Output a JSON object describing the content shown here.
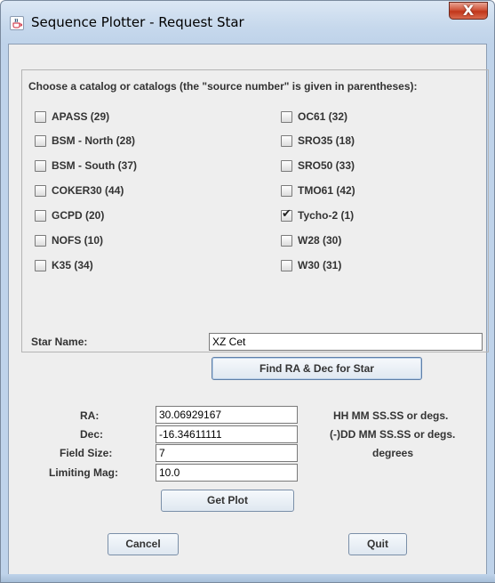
{
  "window": {
    "title": "Sequence Plotter - Request Star",
    "close_glyph": "X",
    "app_icon": "java-cup-icon"
  },
  "catalogs": {
    "heading": "Choose a catalog or catalogs (the \"source number\" is given in parentheses):",
    "left": [
      {
        "label": "APASS (29)",
        "checked": false
      },
      {
        "label": "BSM - North (28)",
        "checked": false
      },
      {
        "label": "BSM - South (37)",
        "checked": false
      },
      {
        "label": "COKER30 (44)",
        "checked": false
      },
      {
        "label": "GCPD (20)",
        "checked": false
      },
      {
        "label": "NOFS (10)",
        "checked": false
      },
      {
        "label": "K35 (34)",
        "checked": false
      }
    ],
    "right": [
      {
        "label": "OC61 (32)",
        "checked": false
      },
      {
        "label": "SRO35 (18)",
        "checked": false
      },
      {
        "label": "SRO50 (33)",
        "checked": false
      },
      {
        "label": "TMO61 (42)",
        "checked": false
      },
      {
        "label": "Tycho-2 (1)",
        "checked": true
      },
      {
        "label": "W28 (30)",
        "checked": false
      },
      {
        "label": "W30 (31)",
        "checked": false
      }
    ]
  },
  "star": {
    "name_label": "Star Name:",
    "name_value": "XZ Cet",
    "find_button": "Find RA & Dec for Star"
  },
  "coords": {
    "ra_label": "RA:",
    "ra_value": "30.06929167",
    "ra_hint": "HH MM SS.SS or degs.",
    "dec_label": "Dec:",
    "dec_value": "-16.34611111",
    "dec_hint": "(-)DD MM SS.SS or degs.",
    "fs_label": "Field Size:",
    "fs_value": "7",
    "fs_hint": "degrees",
    "mag_label": "Limiting Mag:",
    "mag_value": "10.0",
    "get_plot": "Get Plot"
  },
  "actions": {
    "cancel": "Cancel",
    "quit": "Quit"
  }
}
